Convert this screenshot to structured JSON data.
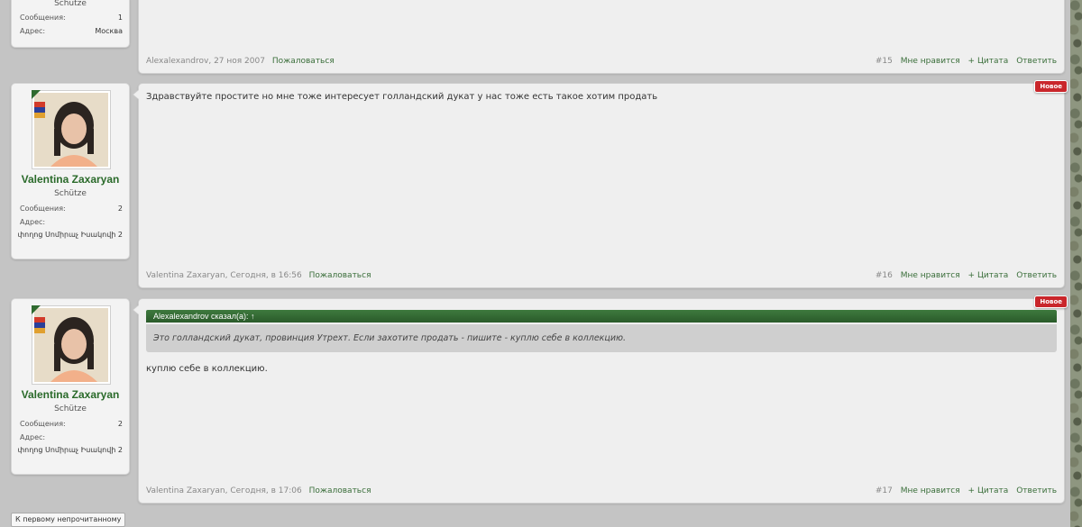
{
  "top_post": {
    "user": {
      "title": "Schütze",
      "messages_label": "Сообщения:",
      "messages_value": "1",
      "address_label": "Адрес:",
      "address_value": "Москва"
    },
    "footer": {
      "author_date": "Alexalexandrov, 27 ноя 2007",
      "report": "Пожаловаться",
      "number": "#15",
      "like": "Мне нравится",
      "quote": "+ Цитата",
      "reply": "Ответить"
    }
  },
  "posts": [
    {
      "user": {
        "name": "Valentina Zaxaryan",
        "title": "Schütze",
        "messages_label": "Сообщения:",
        "messages_value": "2",
        "address_label": "Адрес:",
        "address_value": "փողոց Սոմիրաչ Իսակովի 2"
      },
      "badge": "Новое",
      "text": "Здравствуйте простите но мне тоже интересует голландский дукат у нас тоже есть такое хотим продать",
      "footer": {
        "author_date": "Valentina Zaxaryan, Сегодня, в 16:56",
        "report": "Пожаловаться",
        "number": "#16",
        "like": "Мне нравится",
        "quote": "+ Цитата",
        "reply": "Ответить"
      }
    },
    {
      "user": {
        "name": "Valentina Zaxaryan",
        "title": "Schütze",
        "messages_label": "Сообщения:",
        "messages_value": "2",
        "address_label": "Адрес:",
        "address_value": "փողոց Սոմիրաչ Իսակովի 2"
      },
      "badge": "Новое",
      "quote_header": "Alexalexandrov сказал(а): ↑",
      "quote_text": "Это голландский дукат, провинция Утрехт. Если захотите продать - пишите - куплю себе в коллекцию.",
      "text": "куплю себе в коллекцию.",
      "footer": {
        "author_date": "Valentina Zaxaryan, Сегодня, в 17:06",
        "report": "Пожаловаться",
        "number": "#17",
        "like": "Мне нравится",
        "quote": "+ Цитата",
        "reply": "Ответить"
      }
    }
  ],
  "jump_button": "К первому непрочитанному"
}
